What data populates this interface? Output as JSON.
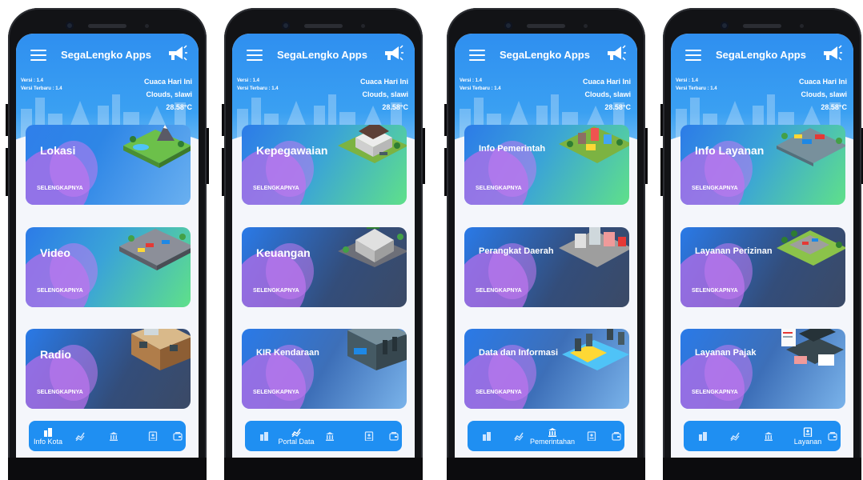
{
  "app": {
    "title": "SegaLengko Apps",
    "version": "Versi : 1.4",
    "latest_version": "Versi Terbaru : 1.4",
    "weather_label": "Cuaca Hari Ini",
    "weather_desc": "Clouds, slawi",
    "temperature": "28.58°C"
  },
  "more_label": "SELENGKAPNYA",
  "screens": [
    {
      "cards": [
        {
          "title": "Lokasi",
          "style": "grad-a",
          "art": "mountain-park"
        },
        {
          "title": "Video",
          "style": "grad-b",
          "art": "traffic-road"
        },
        {
          "title": "Radio",
          "style": "grad-c",
          "art": "studio-room"
        }
      ],
      "active_nav": "Info Kota"
    },
    {
      "cards": [
        {
          "title": "Kepegawaian",
          "style": "grad-b",
          "art": "house"
        },
        {
          "title": "Keuangan",
          "style": "grad-c",
          "art": "bank"
        },
        {
          "title": "KIR Kendaraan",
          "style": "grad-d",
          "art": "garage"
        }
      ],
      "active_nav": "Portal Data"
    },
    {
      "cards": [
        {
          "title": "Info Pemerintah",
          "style": "grad-b",
          "art": "city-block"
        },
        {
          "title": "Perangkat Daerah",
          "style": "grad-c",
          "art": "office-blocks"
        },
        {
          "title": "Data dan Informasi",
          "style": "grad-d",
          "art": "server-network"
        }
      ],
      "active_nav": "Pemerintahan"
    },
    {
      "cards": [
        {
          "title": "Info Layanan",
          "style": "grad-b",
          "art": "parking-lot"
        },
        {
          "title": "Layanan Perizinan",
          "style": "grad-c",
          "art": "parking-park"
        },
        {
          "title": "Layanan Pajak",
          "style": "grad-d",
          "art": "documents-laptop"
        }
      ],
      "active_nav": "Layanan"
    }
  ],
  "nav": [
    {
      "label": "Info Kota",
      "icon": "city-icon"
    },
    {
      "label": "Portal Data",
      "icon": "chart-line-icon"
    },
    {
      "label": "Pemerintahan",
      "icon": "government-icon"
    },
    {
      "label": "Layanan",
      "icon": "service-id-icon"
    },
    {
      "label": "",
      "icon": "wallet-icon"
    }
  ],
  "colors": {
    "header_blue": "#2f8ff0",
    "nav_blue": "#1f8ff2",
    "accent_purple": "#b46de8",
    "accent_green": "#5fe08a"
  }
}
